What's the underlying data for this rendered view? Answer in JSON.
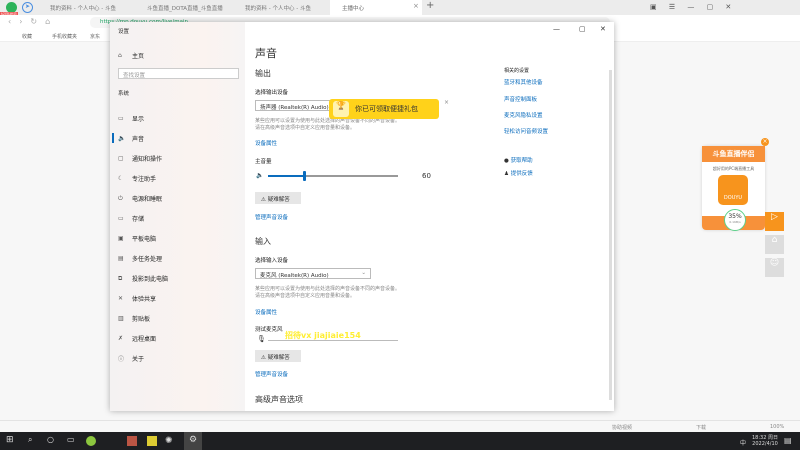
{
  "browser": {
    "badge": "好团战号",
    "tabs": [
      "我的资料 - 个人中心 - 斗鱼",
      "斗鱼直播_DOTA直播_斗鱼直播",
      "我的资料 - 个人中心 - 斗鱼",
      "主播中心"
    ],
    "url": "https://mp.douyu.com/live/main",
    "bookmarks": [
      "收藏",
      "手机收藏夹",
      "京东"
    ],
    "status_right": [
      "下载",
      "100%"
    ],
    "status_left": "协助视频"
  },
  "settings": {
    "window_title": "设置",
    "sidebar": {
      "home": "主页",
      "search_placeholder": "查找设置",
      "section": "系统",
      "items": [
        "显示",
        "声音",
        "通知和操作",
        "专注助手",
        "电源和睡眠",
        "存储",
        "平板电脑",
        "多任务处理",
        "投影到此电脑",
        "体验共享",
        "剪贴板",
        "远程桌面",
        "关于"
      ]
    },
    "page_title": "声音",
    "output": {
      "heading": "输出",
      "select_label": "选择输出设备",
      "device": "扬声器 (Realtek(R) Audio)",
      "desc1": "某些应用可以设置为使用与此处选择的声音设备不同的声音设备。",
      "desc2": "请在高级声音选项中自定义应用音量和设备。",
      "properties": "设备属性",
      "volume_label": "主音量",
      "volume": 60,
      "troubleshoot": "疑难解答",
      "manage": "管理声音设备"
    },
    "input": {
      "heading": "输入",
      "select_label": "选择输入设备",
      "device": "麦克风 (Realtek(R) Audio)",
      "desc1": "某些应用可以设置为使用与此处选择的声音设备不同的声音设备。",
      "desc2": "请在高级声音选项中自定义应用音量和设备。",
      "properties": "设备属性",
      "test_label": "测试麦克风",
      "troubleshoot": "疑难解答",
      "manage": "管理声音设备"
    },
    "advanced": "高级声音选项",
    "related": {
      "heading": "相关的设置",
      "links": [
        "蓝牙和其他设备",
        "声音控制面板",
        "麦克风隐私设置",
        "轻松访问音频设置"
      ],
      "help": "获取帮助",
      "feedback": "提供反馈"
    }
  },
  "overlay": {
    "toast": "你已可领取便捷礼包",
    "watermark": "招待vx jiajiaie154"
  },
  "ad": {
    "title": "斗鱼直播伴侣",
    "subtitle": "超好用的PC端直播工具",
    "logo": "DOUYU",
    "percent": "35%",
    "percent_sub": "0.1KB/s"
  },
  "taskbar": {
    "time": "18:32 周日",
    "date": "2022/4/10",
    "ime": "中"
  }
}
